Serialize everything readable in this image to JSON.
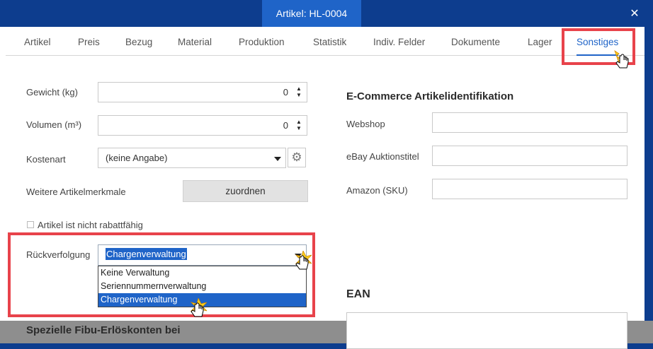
{
  "window": {
    "title": "Artikel: HL-0004",
    "close_glyph": "✕"
  },
  "tabs": [
    {
      "label": "Artikel"
    },
    {
      "label": "Preis"
    },
    {
      "label": "Bezug"
    },
    {
      "label": "Material"
    },
    {
      "label": "Produktion"
    },
    {
      "label": "Statistik"
    },
    {
      "label": "Indiv. Felder"
    },
    {
      "label": "Dokumente"
    },
    {
      "label": "Lager"
    },
    {
      "label": "Sonstiges",
      "active": true
    }
  ],
  "left": {
    "weight": {
      "label": "Gewicht (kg)",
      "value": "0"
    },
    "volume": {
      "label": "Volumen (m³)",
      "value": "0"
    },
    "cost_type": {
      "label": "Kostenart",
      "value": "(keine Angabe)"
    },
    "more_features": {
      "label": "Weitere Artikelmerkmale",
      "button": "zuordnen"
    },
    "no_discount": {
      "label": "Artikel ist nicht rabattfähig",
      "checked": false
    },
    "traceability": {
      "label": "Rückverfolgung",
      "value": "Chargenverwaltung",
      "options": [
        "Keine Verwaltung",
        "Seriennummernverwaltung",
        "Chargenverwaltung"
      ],
      "selected_index": 2
    },
    "fibu_title": "Spezielle Fibu-Erlöskonten bei"
  },
  "right": {
    "ecommerce_title": "E-Commerce Artikelidentifikation",
    "webshop": {
      "label": "Webshop",
      "value": ""
    },
    "ebay": {
      "label": "eBay Auktionstitel",
      "value": ""
    },
    "amazon": {
      "label": "Amazon (SKU)",
      "value": ""
    },
    "ean_title": "EAN"
  },
  "colors": {
    "accent": "#1f64c8",
    "titlebar": "#0d3d8e",
    "highlight": "#e8434b"
  }
}
